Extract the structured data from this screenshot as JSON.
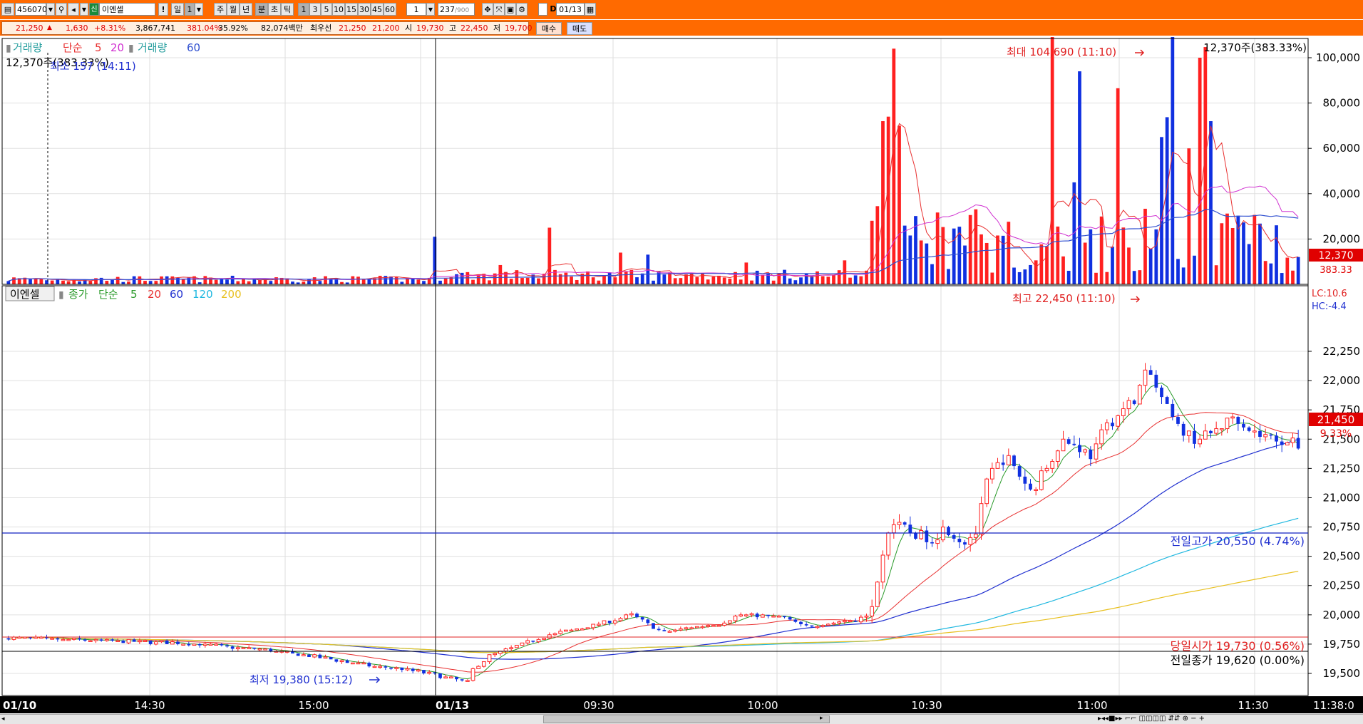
{
  "toolbar": {
    "code": "456070",
    "name_badge": "신",
    "name": "이엔셀",
    "alert": "!",
    "periods": [
      "일",
      "1",
      "주",
      "월",
      "년",
      "분",
      "초",
      "틱"
    ],
    "minutes": [
      "1",
      "3",
      "5",
      "10",
      "15",
      "30",
      "45",
      "60"
    ],
    "count": "1",
    "bars_current": "237",
    "bars_total": "/900",
    "date": "01/13"
  },
  "info": {
    "price": "21,250",
    "change": "1,630",
    "change_pct": "+8.31%",
    "volume": "3,867,741",
    "vol_ratio": "381.04%",
    "turnover": "35.92%",
    "amount": "82,074백만",
    "best_label": "최우선",
    "ask": "21,250",
    "bid": "21,200",
    "open_label": "시",
    "open": "19,730",
    "high_label": "고",
    "high": "22,450",
    "low_label": "저",
    "low": "19,700",
    "buy": "매수",
    "sell": "매도"
  },
  "volume_panel": {
    "legend_name": "거래량",
    "legend_type": "단순",
    "ma5": "5",
    "ma20": "20",
    "legend_name2": "거래량",
    "ma60": "60",
    "current_text": "12,370주(383.33%)",
    "min_text": "최소 157 (14:11)",
    "max_text": "최대 104,690 (11:10)",
    "right_text": "12,370주(383.33%)",
    "current_box": "12,370",
    "current_pct": "383.33",
    "y_ticks": [
      "100,000",
      "80,000",
      "60,000",
      "40,000",
      "20,000"
    ]
  },
  "price_panel": {
    "name": "이엔셀",
    "legend_label": "종가",
    "legend_type": "단순",
    "ma5": "5",
    "ma20": "20",
    "ma60": "60",
    "ma120": "120",
    "ma200": "200",
    "high_text": "최고 22,450 (11:10)",
    "low_text": "최저 19,380 (15:12)",
    "prev_high": "전일고가 20,550 (4.74%)",
    "today_open": "당일시가 19,730 (0.56%)",
    "prev_close": "전일종가 19,620 (0.00%)",
    "current_box": "21,450",
    "current_pct": "9.33%",
    "lc": "LC:10.6",
    "hc": "HC:-4.4",
    "y_ticks": [
      "22,250",
      "22,000",
      "21,750",
      "21,500",
      "21,250",
      "21,000",
      "20,750",
      "20,500",
      "20,250",
      "20,000",
      "19,750",
      "19,500"
    ]
  },
  "x_axis": {
    "labels": [
      "01/10",
      "14:30",
      "15:00",
      "01/13",
      "09:30",
      "10:00",
      "10:30",
      "11:00",
      "11:30",
      "11:38:0"
    ]
  },
  "colors": {
    "up": "#ff2020",
    "down": "#1030e0",
    "ma5": "#2a9a2a",
    "ma20": "#e83030",
    "ma60": "#2030d0",
    "ma120": "#20b8e0",
    "ma200": "#e8c020",
    "vma60": "#3050d0",
    "toolbar": "#ff6a00"
  }
}
